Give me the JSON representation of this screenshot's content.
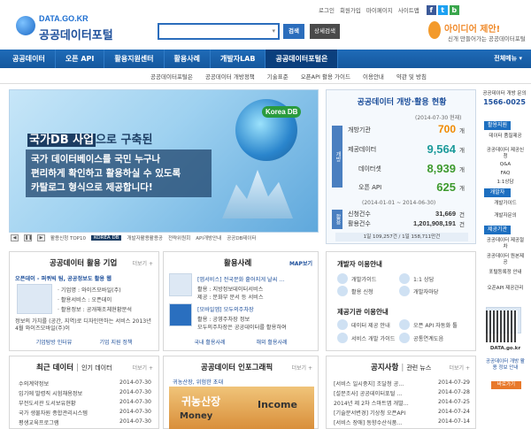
{
  "top_links": [
    "로그인",
    "회원가입",
    "마이페이지",
    "사이트맵"
  ],
  "sns": [
    "f",
    "t",
    "b"
  ],
  "logo": {
    "sub": "DATA.GO.KR",
    "title": "공공데이터포털"
  },
  "search": {
    "placeholder": "",
    "submit": "검색",
    "advanced": "상세검색"
  },
  "idea": {
    "title": "아이디어 제안!",
    "sub": "신개 만들어가는 공공데이터포털"
  },
  "nav": {
    "items": [
      "공공데이터",
      "오픈 API",
      "활용지원센터",
      "활용사례",
      "개발자LAB",
      "공공데이터포털은"
    ],
    "all": "전체메뉴 ▾"
  },
  "subnav": [
    "공공데이터포털은",
    "공공데이터 개방정책",
    "기술표준",
    "오픈API 활용 가이드",
    "이용안내",
    "약관 및 방침"
  ],
  "banner": {
    "tag": "Korea DB",
    "line1_hl": "국가DB 사업",
    "line1_rest": "으로 구축된",
    "line2": "국가 데이터베이스를 국민 누구나",
    "line3": "편리하게 확인하고 활용하실 수 있도록",
    "line4": "카탈로그 형식으로 제공합니다!",
    "tabs": [
      "활용신청 TOP10",
      "KOREA DB",
      "개발자활용활용공",
      "전략위원회",
      "API개방안내",
      "공공DB테이터"
    ]
  },
  "stats": {
    "title": "공공데이터 개방·활용 현황",
    "date1": "(2014-07-30 현재)",
    "side1": "개방",
    "rows": [
      {
        "label": "개방기관",
        "value": "700",
        "unit": "개"
      },
      {
        "label": "제공데이터",
        "value": "9,564",
        "unit": "개"
      },
      {
        "label": "데이터셋",
        "value": "8,939",
        "unit": "개"
      },
      {
        "label": "오픈 API",
        "value": "625",
        "unit": "개"
      }
    ],
    "date2": "(2014-01-01 ~ 2014-06-30)",
    "side2": "활용",
    "rows2": [
      {
        "label": "신청건수",
        "value": "31,669",
        "unit": "건"
      },
      {
        "label": "활용건수",
        "value": "1,201,908,191",
        "unit": "건"
      }
    ],
    "foot": "1일 109,257건  /  1일 158,711만건"
  },
  "side": {
    "call_label": "공공데이터 개방 문의",
    "call_number": "1566-0025",
    "heads": [
      "활용지원",
      "개발자",
      "제공기관"
    ],
    "links1": [
      "데이터 품질제공",
      "공공데이터 제공신청",
      "Q&A",
      "FAQ",
      "1:1상담"
    ],
    "links2": [
      "개발가이드",
      "개발자문의"
    ],
    "links3": [
      "공공데이터 제공절차",
      "공공데이터 원본제공",
      "포털등록정 안내",
      "오픈API 제공관리"
    ],
    "qr_label": "DATA.go.kr"
  },
  "use_company": {
    "title": "공공데이터 활용 기업",
    "more": "더보기 +",
    "name": "오픈데이 - 퍼퀴빅 팀, 공공정보도 활용 웹",
    "lines": [
      "· 기업명 : 와이즈모바일(주)",
      "· 활용서비스 : 오픈데이",
      "· 활용정보 : 공개해조체현황분석"
    ],
    "desc": "정보의 가치를 (공간, 지역)로 디자인만하는 서비스 2013년 4월 와이즈모바일(주)이",
    "btns": [
      "기업탐방 인터뷰",
      "기업 지원 정책"
    ]
  },
  "use_case": {
    "title": "활용사례",
    "more": "MAP보기",
    "items": [
      {
        "t": "[앱서비스] 전국문화 흩어지게 날씨 ...",
        "s": "활용 : 지방정보데이터서비스",
        "s2": "제공 : 문화부 문서 등 서비스"
      },
      {
        "t": "[모바일앱] 모두의주차장",
        "s": "활용 : 공영주차장 정보",
        "s2": "모두의주차장은 공공데이터를 활용하여"
      }
    ],
    "btns": [
      "국내 활용사례",
      "해외 활용사례"
    ]
  },
  "dev_guide": {
    "title": "개발자 이용안내",
    "items": [
      "개발가이드",
      "1:1 상담",
      "활용 신청",
      "개발자마당"
    ]
  },
  "provider": {
    "title": "제공기관 이용안내",
    "items": [
      "데이터 제공 안내",
      "오픈 API 자동화 툴",
      "서비스 개발 가이드",
      "공통연계도음"
    ]
  },
  "recent": {
    "title": "최근 데이터",
    "tab2": "인기 데이터",
    "more": "더보기 +",
    "rows": [
      {
        "t": "수의계약정보",
        "d": "2014-07-30"
      },
      {
        "t": "입기에 발령직 시험채용정보",
        "d": "2014-07-30"
      },
      {
        "t": "부전도서관 도서보유현황",
        "d": "2014-07-30"
      },
      {
        "t": "국가 생물자원 종합관리시스템",
        "d": "2014-07-30"
      },
      {
        "t": "평생교육프로그램",
        "d": "2014-07-30"
      }
    ]
  },
  "infographic": {
    "title": "공공데이터 인포그래픽",
    "more": "더보기 +",
    "caption": "귀농산장, 위험한 초대",
    "img_title": "귀농산장",
    "img_money": "Money",
    "img_income": "Income"
  },
  "notice": {
    "title": "공지사항",
    "tab2": "관련 뉴스",
    "more": "더보기 +",
    "rows": [
      {
        "t": "[서비스 일시중지] 조달청 공...",
        "d": "2014-07-29"
      },
      {
        "t": "[설문조사] 공공데이터포털 ...",
        "d": "2014-07-28"
      },
      {
        "t": "2014년 제 2차 스마트앱 개발...",
        "d": "2014-07-25"
      },
      {
        "t": "[기술문서변경] 기상청 오픈API",
        "d": "2014-07-24"
      },
      {
        "t": "[서비스 장애] 동향수산식품...",
        "d": "2014-07-14"
      }
    ]
  },
  "promo": {
    "text": "공공데이터 개방 활용 정보 안내",
    "btn": "바로가기"
  }
}
